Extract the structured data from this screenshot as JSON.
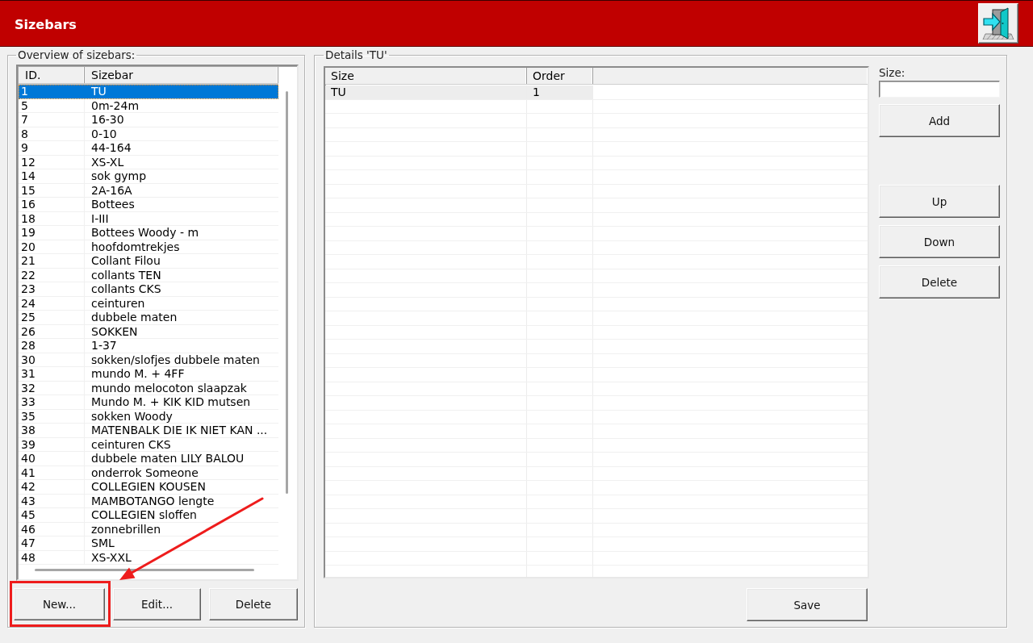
{
  "window": {
    "title": "Sizebars"
  },
  "overview": {
    "title": "Overview of sizebars:",
    "columns": [
      "ID.",
      "Sizebar"
    ],
    "rows": [
      {
        "id": "1",
        "name": "TU",
        "selected": true
      },
      {
        "id": "5",
        "name": "0m-24m",
        "selected": false
      },
      {
        "id": "7",
        "name": "16-30",
        "selected": false
      },
      {
        "id": "8",
        "name": "0-10",
        "selected": false
      },
      {
        "id": "9",
        "name": "44-164",
        "selected": false
      },
      {
        "id": "12",
        "name": "XS-XL",
        "selected": false
      },
      {
        "id": "14",
        "name": "sok gymp",
        "selected": false
      },
      {
        "id": "15",
        "name": "2A-16A",
        "selected": false
      },
      {
        "id": "16",
        "name": "Bottees",
        "selected": false
      },
      {
        "id": "18",
        "name": "I-III",
        "selected": false
      },
      {
        "id": "19",
        "name": "Bottees Woody - m",
        "selected": false
      },
      {
        "id": "20",
        "name": "hoofdomtrekjes",
        "selected": false
      },
      {
        "id": "21",
        "name": "Collant Filou",
        "selected": false
      },
      {
        "id": "22",
        "name": "collants TEN",
        "selected": false
      },
      {
        "id": "23",
        "name": "collants CKS",
        "selected": false
      },
      {
        "id": "24",
        "name": "ceinturen",
        "selected": false
      },
      {
        "id": "25",
        "name": "dubbele maten",
        "selected": false
      },
      {
        "id": "26",
        "name": "SOKKEN",
        "selected": false
      },
      {
        "id": "28",
        "name": "1-37",
        "selected": false
      },
      {
        "id": "30",
        "name": "sokken/slofjes dubbele maten",
        "selected": false
      },
      {
        "id": "31",
        "name": "mundo M. + 4FF",
        "selected": false
      },
      {
        "id": "32",
        "name": "mundo melocoton slaapzak",
        "selected": false
      },
      {
        "id": "33",
        "name": "Mundo M. + KIK KID mutsen",
        "selected": false
      },
      {
        "id": "35",
        "name": "sokken Woody",
        "selected": false
      },
      {
        "id": "38",
        "name": "MATENBALK DIE IK NIET KAN ...",
        "selected": false
      },
      {
        "id": "39",
        "name": "ceinturen CKS",
        "selected": false
      },
      {
        "id": "40",
        "name": "dubbele maten LILY BALOU",
        "selected": false
      },
      {
        "id": "41",
        "name": "onderrok Someone",
        "selected": false
      },
      {
        "id": "42",
        "name": "COLLEGIEN KOUSEN",
        "selected": false
      },
      {
        "id": "43",
        "name": "MAMBOTANGO lengte",
        "selected": false
      },
      {
        "id": "45",
        "name": "COLLEGIEN sloffen",
        "selected": false
      },
      {
        "id": "46",
        "name": "zonnebrillen",
        "selected": false
      },
      {
        "id": "47",
        "name": "SML",
        "selected": false
      },
      {
        "id": "48",
        "name": "XS-XXL",
        "selected": false
      }
    ],
    "buttons": [
      "New...",
      "Edit...",
      "Delete"
    ]
  },
  "details": {
    "title": "Details 'TU'",
    "columns": [
      "Size",
      "Order"
    ],
    "rows": [
      {
        "size": "TU",
        "order": "1",
        "selected": true
      }
    ],
    "size_field": {
      "label": "Size:",
      "button": "Add"
    },
    "row_buttons": [
      "Up",
      "Down",
      "Delete"
    ],
    "save_button": "Save"
  }
}
